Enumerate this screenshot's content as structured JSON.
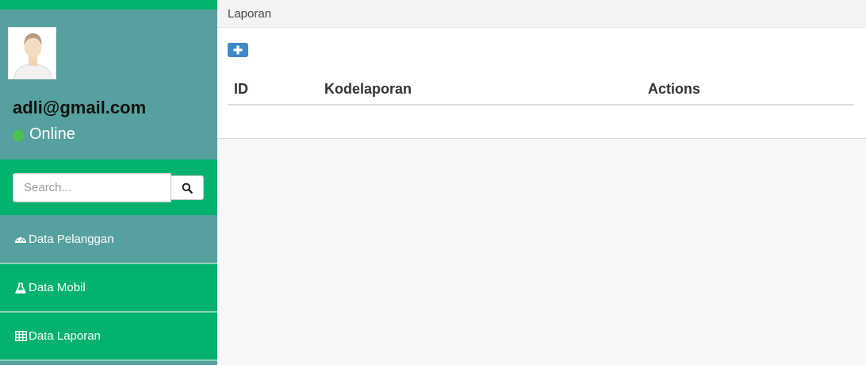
{
  "profile": {
    "email": "adli@gmail.com",
    "status": "Online",
    "status_color": "#4cc34c"
  },
  "search": {
    "placeholder": "Search...",
    "button_icon": "search-icon"
  },
  "sidebar": {
    "items": [
      {
        "label": "Data Pelanggan",
        "icon": "dashboard-icon"
      },
      {
        "label": "Data Mobil",
        "icon": "flask-icon"
      },
      {
        "label": "Data Laporan",
        "icon": "table-icon"
      }
    ]
  },
  "breadcrumb": {
    "title": "Laporan"
  },
  "toolbar": {
    "add_icon": "plus-icon"
  },
  "table": {
    "columns": [
      "ID",
      "Kodelaporan",
      "Actions"
    ],
    "rows": []
  },
  "colors": {
    "sidebar_teal": "#56a19f",
    "sidebar_green": "#03b26c",
    "add_button_blue": "#3f88c9"
  }
}
